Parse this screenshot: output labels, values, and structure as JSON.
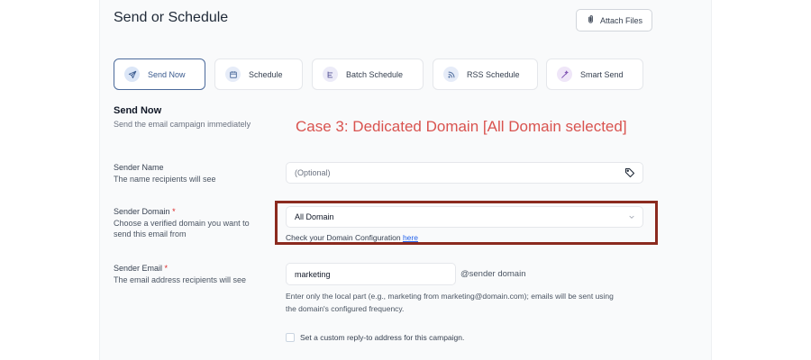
{
  "header": {
    "title": "Send or Schedule",
    "attach_label": "Attach Files",
    "attach_icon": "paperclip-icon"
  },
  "tabs": [
    {
      "label": "Send Now",
      "icon": "send-icon",
      "active": true
    },
    {
      "label": "Schedule",
      "icon": "calendar-icon",
      "active": false
    },
    {
      "label": "Batch Schedule",
      "icon": "batch-icon",
      "active": false
    },
    {
      "label": "RSS Schedule",
      "icon": "rss-icon",
      "active": false
    },
    {
      "label": "Smart Send",
      "icon": "wand-icon",
      "active": false
    }
  ],
  "section": {
    "title": "Send Now",
    "subtitle": "Send the email campaign immediately"
  },
  "annotation": "Case 3: Dedicated Domain [All Domain selected]",
  "sender_name": {
    "label": "Sender Name",
    "desc": "The name recipients will see",
    "placeholder": "(Optional)",
    "icon": "tag-icon"
  },
  "sender_domain": {
    "label": "Sender Domain",
    "required": "*",
    "desc_line1": "Choose a verified domain you want to",
    "desc_line2": "send this email from",
    "value": "All Domain",
    "check_text": "Check your Domain Configuration",
    "check_link": "here"
  },
  "sender_email": {
    "label": "Sender Email",
    "required": "*",
    "desc": "The email address recipients will see",
    "value": "marketing",
    "suffix": "@sender domain",
    "note_line1": "Enter only the local part (e.g., marketing from marketing@domain.com); emails will be sent using",
    "note_line2": "the domain's configured frequency."
  },
  "reply_to": {
    "label": "Set a custom reply-to address for this campaign."
  },
  "colors": {
    "active_border": "#4b6a9b",
    "annotation": "#d9534f",
    "highlight_box": "#8b2a1f",
    "required": "#dc2626",
    "link": "#2563eb"
  }
}
